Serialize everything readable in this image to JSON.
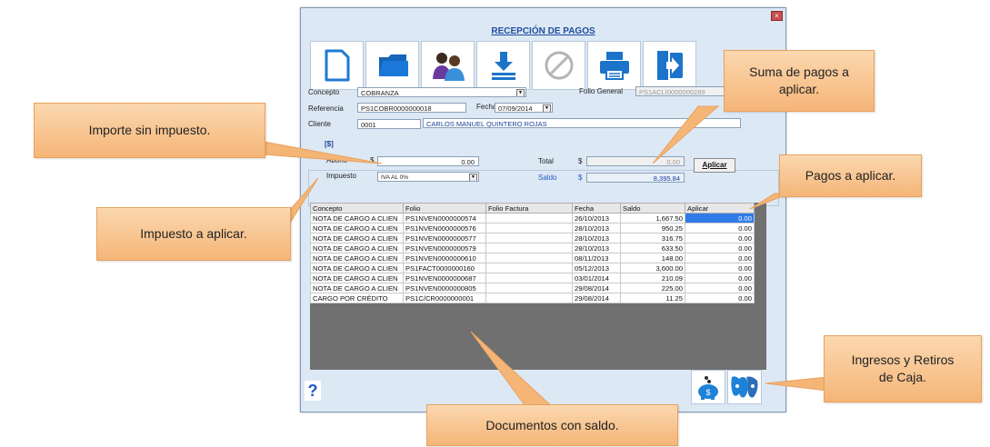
{
  "window": {
    "title": "RECEPCIÓN DE PAGOS",
    "close_glyph": "×"
  },
  "toolbar": {
    "buttons": [
      {
        "icon": "new-document-icon"
      },
      {
        "icon": "folder-icon"
      },
      {
        "icon": "clients-icon"
      },
      {
        "icon": "download-icon"
      },
      {
        "icon": "cancel-icon"
      },
      {
        "icon": "print-icon"
      },
      {
        "icon": "exit-icon"
      }
    ]
  },
  "form": {
    "concepto_label": "Concepto",
    "concepto_value": "COBRANZA",
    "folio_general_label": "Folio General",
    "folio_general_value": "PS1ACLI0000000289",
    "referencia_label": "Referencia",
    "referencia_value": "PS1COBR0000000018",
    "fecha_label": "Fecha",
    "fecha_value": "07/09/2014",
    "cliente_label": "Cliente",
    "cliente_code": "0001",
    "cliente_name": "CARLOS MANUEL QUINTERO ROJAS"
  },
  "pago": {
    "currency_header": "[$]",
    "abono_label": "Abono",
    "currency_symbol": "$",
    "abono_value": "0.00",
    "impuesto_label": "Impuesto",
    "impuesto_value": "IVA AL 0%",
    "total_label": "Total",
    "total_value": "0.00",
    "saldo_label": "Saldo",
    "saldo_value": "8,395.84",
    "aplicar_button": "Aplicar"
  },
  "table": {
    "columns": [
      "Concepto",
      "Folio",
      "Folio Factura",
      "Fecha",
      "Saldo",
      "Aplicar"
    ],
    "rows": [
      [
        "NOTA DE CARGO A CLIEN",
        "PS1NVEN0000000574",
        "",
        "26/10/2013",
        "1,667.50",
        "0.00"
      ],
      [
        "NOTA DE CARGO A CLIEN",
        "PS1NVEN0000000576",
        "",
        "28/10/2013",
        "950.25",
        "0.00"
      ],
      [
        "NOTA DE CARGO A CLIEN",
        "PS1NVEN0000000577",
        "",
        "28/10/2013",
        "316.75",
        "0.00"
      ],
      [
        "NOTA DE CARGO A CLIEN",
        "PS1NVEN0000000579",
        "",
        "28/10/2013",
        "633.50",
        "0.00"
      ],
      [
        "NOTA DE CARGO A CLIEN",
        "PS1NVEN0000000610",
        "",
        "08/11/2013",
        "148.00",
        "0.00"
      ],
      [
        "NOTA DE CARGO A CLIEN",
        "PS1FACT0000000160",
        "",
        "05/12/2013",
        "3,600.00",
        "0.00"
      ],
      [
        "NOTA DE CARGO A CLIEN",
        "PS1NVEN0000000687",
        "",
        "03/01/2014",
        "210.09",
        "0.00"
      ],
      [
        "NOTA DE CARGO A CLIEN",
        "PS1NVEN0000000805",
        "",
        "29/08/2014",
        "225.00",
        "0.00"
      ],
      [
        "CARGO POR CRÉDITO",
        "PS1C/CR0000000001",
        "",
        "29/08/2014",
        "11.25",
        "0.00"
      ]
    ]
  },
  "bottom": {
    "help_glyph": "?",
    "buttons": [
      {
        "icon": "piggy-bank-icon"
      },
      {
        "icon": "cash-in-out-icon"
      }
    ]
  },
  "callouts": {
    "suma_pagos": "Suma de pagos a aplicar.",
    "importe": "Importe sin impuesto.",
    "pagos_aplicar": "Pagos a aplicar.",
    "impuesto": "Impuesto a aplicar.",
    "ingresos": "Ingresos y Retiros de Caja.",
    "documentos": "Documentos con saldo."
  },
  "colors": {
    "callout_fill": "#f5b577",
    "callout_border": "#e8a25e",
    "window_bg": "#dde8f5",
    "accent_blue": "#1f58c8",
    "selection": "#2f7ce8"
  }
}
